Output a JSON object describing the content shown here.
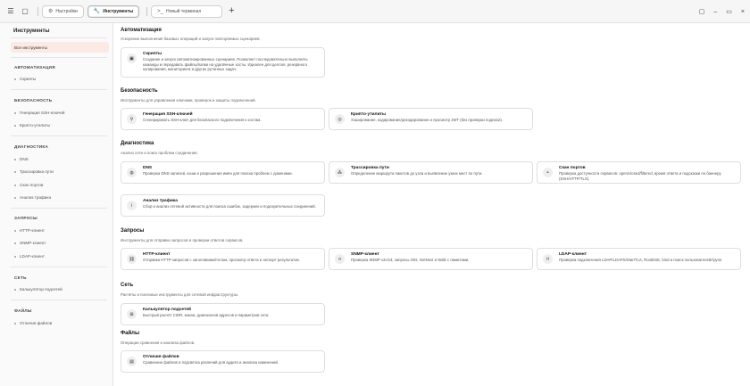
{
  "titlebar": {
    "tabs": [
      {
        "icon": "⚙",
        "label": "Настройки"
      },
      {
        "icon": "🔧",
        "label": "Инструменты"
      },
      {
        "icon": ">_",
        "label": "Новый терминал"
      }
    ],
    "close_glyph": "×"
  },
  "sidebar": {
    "title": "Инструменты",
    "all_tools": "Все инструменты",
    "groups": [
      {
        "title": "АВТОМАТИЗАЦИЯ",
        "items": [
          "Скрипты"
        ]
      },
      {
        "title": "БЕЗОПАСНОСТЬ",
        "items": [
          "Генерация SSH-ключей",
          "Крипто-утилиты"
        ]
      },
      {
        "title": "ДИАГНОСТИКА",
        "items": [
          "DNS",
          "Трассировка пути",
          "Скан портов",
          "Анализ трафика"
        ]
      },
      {
        "title": "ЗАПРОСЫ",
        "items": [
          "HTTP-клиент",
          "SNMP-клиент",
          "LDAP-клиент"
        ]
      },
      {
        "title": "СЕТЬ",
        "items": [
          "Калькулятор подсетей"
        ]
      },
      {
        "title": "ФАЙЛЫ",
        "items": [
          "Отличия файлов"
        ]
      }
    ]
  },
  "sections": [
    {
      "title": "Автоматизация",
      "subtitle": "Ускорение выполнения базовых операций и запуск повторяемых сценариев.",
      "cards": [
        {
          "icon": "scripts-icon",
          "glyph": "▣",
          "title": "Скрипты",
          "desc": "Создание и запуск автоматизированных сценариев. Позволяет последовательно выполнять команды и передавать файлы/папки на удалённые хосты. Идеален для деплоя, резервного копирования, мониторинга и других рутинных задач."
        }
      ]
    },
    {
      "title": "Безопасность",
      "subtitle": "Инструменты для управления ключами, проверок и защиты подключений.",
      "cards": [
        {
          "icon": "key-icon",
          "glyph": "⚲",
          "title": "Генерация SSH-ключей",
          "desc": "Сгенерировать SSH-ключ для безопасного подключения к хостам."
        },
        {
          "icon": "crypto-icon",
          "glyph": "◎",
          "title": "Крипто-утилиты",
          "desc": "Хэширование, кодирование/декодирование и просмотр JWT (без проверки подписи)."
        }
      ]
    },
    {
      "title": "Диагностика",
      "subtitle": "Анализ сети и поиск проблем соединения.",
      "cards": [
        {
          "icon": "globe-icon",
          "glyph": "◍",
          "title": "DNS",
          "desc": "Проверка DNS-записей, кэша и разрешения имён для поиска проблем с доменами."
        },
        {
          "icon": "route-icon",
          "glyph": "⁂",
          "title": "Трассировка пути",
          "desc": "Определение маршрута пакетов до узла и выявление узких мест по пути."
        },
        {
          "icon": "radar-icon",
          "glyph": "◓",
          "title": "Скан портов",
          "desc": "Проверка доступности сервисов: open/closed/filtered, время ответа и подсказки по баннеру (SSH/HTTP/TLS)."
        },
        {
          "icon": "traffic-icon",
          "glyph": "⌇",
          "title": "Анализ трафика",
          "desc": "Сбор и анализ сетевой активности для поиска ошибок, задержек и подозрительных соединений."
        }
      ]
    },
    {
      "title": "Запросы",
      "subtitle": "Инструменты для отправки запросов и проверки ответов сервисов.",
      "cards": [
        {
          "icon": "link-icon",
          "glyph": "⛓",
          "title": "HTTP-клиент",
          "desc": "Отправка HTTP-запросов с заголовками/телом, просмотр ответа и экспорт результатов."
        },
        {
          "icon": "share-icon",
          "glyph": "⋖",
          "title": "SNMP-клиент",
          "desc": "Проверка SNMP v2c/v3, запросы OID, GetNext и Walk с лимитами."
        },
        {
          "icon": "lock-icon",
          "glyph": "⊓",
          "title": "LDAP-клиент",
          "desc": "Проверка подключения LDAP/LDAPS/StartTLS, RootDSE, bind и поиск пользователей/групп."
        }
      ]
    },
    {
      "title": "Сеть",
      "subtitle": "Расчёты и полезные инструменты для сетевой инфраструктуры.",
      "cards": [
        {
          "icon": "calculator-icon",
          "glyph": "⊞",
          "title": "Калькулятор подсетей",
          "desc": "Быстрый расчёт CIDR, маски, диапазонов адресов и параметров сети."
        }
      ]
    },
    {
      "title": "Файлы",
      "subtitle": "Операции сравнения и анализа файлов.",
      "cards": [
        {
          "icon": "file-diff-icon",
          "glyph": "▤",
          "title": "Отличия файлов",
          "desc": "Сравнение файлов и подсветка различий для аудита и анализа изменений."
        }
      ]
    }
  ]
}
